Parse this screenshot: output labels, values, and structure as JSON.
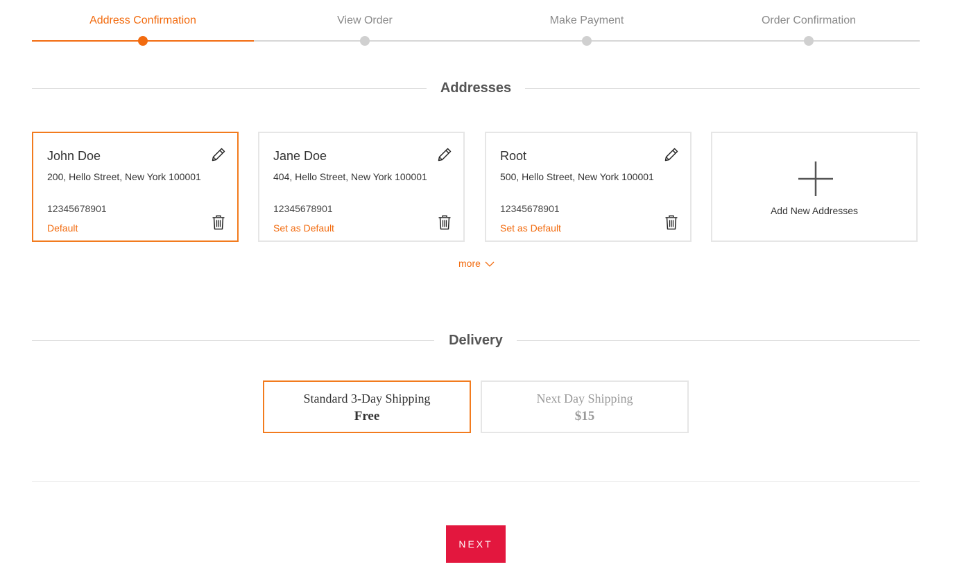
{
  "colors": {
    "accent": "#f26b0f",
    "next_button": "#e3173e",
    "inactive": "#d0d0d0"
  },
  "steps": [
    {
      "label": "Address Confirmation",
      "active": true
    },
    {
      "label": "View Order",
      "active": false
    },
    {
      "label": "Make Payment",
      "active": false
    },
    {
      "label": "Order Confirmation",
      "active": false
    }
  ],
  "addresses_section": {
    "title": "Addresses"
  },
  "addresses": [
    {
      "name": "John Doe",
      "street": "200, Hello Street, New York 100001",
      "phone": "12345678901",
      "default_label": "Default",
      "selected": true,
      "edit_icon": "pencil-icon",
      "delete_icon": "trash-icon"
    },
    {
      "name": "Jane Doe",
      "street": "404, Hello Street, New York 100001",
      "phone": "12345678901",
      "default_label": "Set as Default",
      "selected": false,
      "edit_icon": "pencil-icon",
      "delete_icon": "trash-icon"
    },
    {
      "name": "Root",
      "street": "500, Hello Street, New York 100001",
      "phone": "12345678901",
      "default_label": "Set as Default",
      "selected": false,
      "edit_icon": "pencil-icon",
      "delete_icon": "trash-icon"
    }
  ],
  "add_address": {
    "label": "Add New Addresses",
    "icon": "plus-icon"
  },
  "more": {
    "label": "more",
    "icon": "chevron-down-icon"
  },
  "delivery_section": {
    "title": "Delivery"
  },
  "delivery_options": [
    {
      "name": "Standard 3-Day Shipping",
      "price": "Free",
      "selected": true
    },
    {
      "name": "Next Day Shipping",
      "price": "$15",
      "selected": false
    }
  ],
  "next_button": {
    "label": "NEXT"
  }
}
